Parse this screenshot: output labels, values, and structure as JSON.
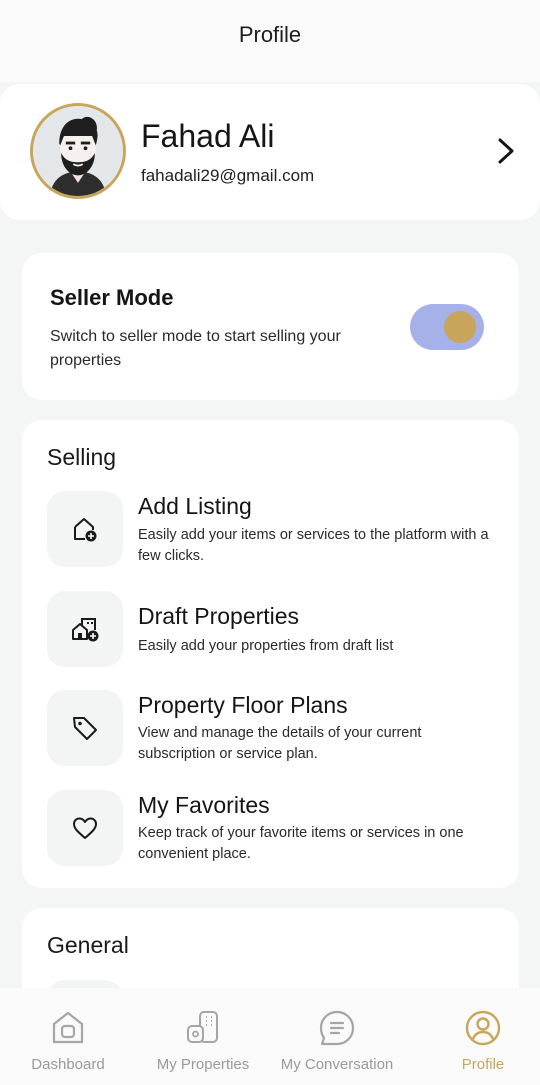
{
  "header": {
    "title": "Profile"
  },
  "profile": {
    "name": "Fahad Ali",
    "email": "fahadali29@gmail.com"
  },
  "seller_mode": {
    "title": "Seller Mode",
    "description": "Switch to seller mode to start selling your properties",
    "enabled": true
  },
  "selling": {
    "title": "Selling",
    "items": [
      {
        "title": "Add Listing",
        "description": "Easily add your items or services to the platform with a few clicks.",
        "icon": "home-plus-icon"
      },
      {
        "title": "Draft Properties",
        "description": "Easily add your properties from draft list",
        "icon": "buildings-plus-icon"
      },
      {
        "title": "Property Floor Plans",
        "description": "View and manage the details of your current subscription or service plan.",
        "icon": "tag-icon"
      },
      {
        "title": "My Favorites",
        "description": "Keep track of your favorite items or services in one convenient place.",
        "icon": "heart-icon"
      }
    ]
  },
  "general": {
    "title": "General"
  },
  "bottom_nav": {
    "items": [
      {
        "label": "Dashboard",
        "icon": "dashboard-icon",
        "active": false
      },
      {
        "label": "My Properties",
        "icon": "properties-icon",
        "active": false
      },
      {
        "label": "My Conversation",
        "icon": "conversation-icon",
        "active": false
      },
      {
        "label": "Profile",
        "icon": "profile-icon",
        "active": true
      }
    ]
  },
  "colors": {
    "accent": "#c9a55b",
    "toggle_track": "#a6b1e9",
    "inactive_nav": "#9a9a9a"
  }
}
